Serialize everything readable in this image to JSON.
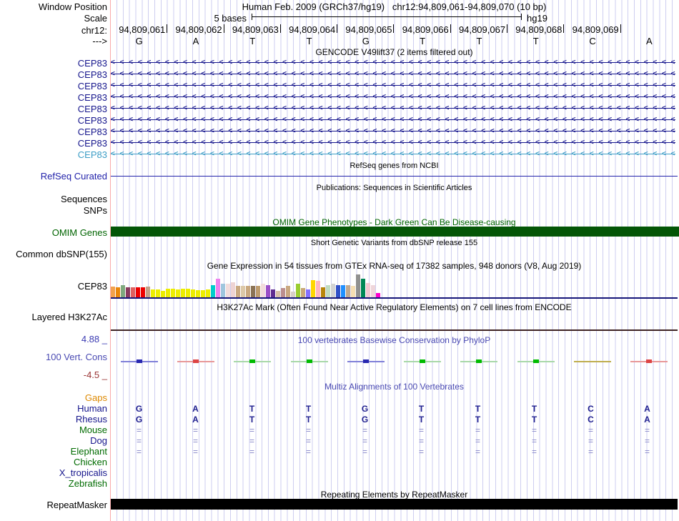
{
  "header": {
    "window_position_label": "Window Position",
    "title": "Human Feb. 2009 (GRCh37/hg19)   chr12:94,809,061-94,809,070 (10 bp)",
    "scale_label": "Scale",
    "scale_text": "5 bases",
    "assembly": "hg19",
    "chrom_label": "chr12:",
    "direction_label": "--->",
    "positions": [
      "94,809,061",
      "94,809,062",
      "94,809,063",
      "94,809,064",
      "94,809,065",
      "94,809,066",
      "94,809,067",
      "94,809,068",
      "94,809,069"
    ],
    "bases": [
      "G",
      "A",
      "T",
      "T",
      "G",
      "T",
      "T",
      "T",
      "C",
      "A"
    ]
  },
  "gencode": {
    "title": "GENCODE V49lift37 (2 items filtered out)",
    "arrow_char": "<",
    "items": [
      {
        "label": "CEP83",
        "color": "#15158C"
      },
      {
        "label": "CEP83",
        "color": "#15158C"
      },
      {
        "label": "CEP83",
        "color": "#15158C"
      },
      {
        "label": "CEP83",
        "color": "#15158C"
      },
      {
        "label": "CEP83",
        "color": "#15158C"
      },
      {
        "label": "CEP83",
        "color": "#15158C"
      },
      {
        "label": "CEP83",
        "color": "#15158C"
      },
      {
        "label": "CEP83",
        "color": "#15158C"
      },
      {
        "label": "CEP83",
        "color": "#3C9DC6"
      }
    ]
  },
  "refseq": {
    "title": "RefSeq genes from NCBI",
    "label": "RefSeq Curated",
    "color": "#2222AA"
  },
  "publications": {
    "title": "Publications: Sequences in Scientific Articles",
    "sequences_label": "Sequences",
    "snps_label": "SNPs"
  },
  "omim": {
    "title": "OMIM Gene Phenotypes - Dark Green Can Be Disease-causing",
    "label": "OMIM Genes",
    "text_color": "#006400",
    "bar_color": "#045606"
  },
  "dbsnp": {
    "title": "Short Genetic Variants from dbSNP release 155",
    "label": "Common dbSNP(155)"
  },
  "gtex": {
    "title": "Gene Expression in 54 tissues from GTEx RNA-seq of 17382 samples, 948 donors (V8, Aug 2019)",
    "label": "CEP83",
    "baseline_color": "#151578"
  },
  "h3k27ac": {
    "title": "H3K27Ac Mark (Often Found Near Active Regulatory Elements) on 7 cell lines from ENCODE",
    "label": "Layered H3K27Ac",
    "baseline_color": "#3E2323"
  },
  "conservation": {
    "title": "100 vertebrates Basewise Conservation by PhyloP",
    "label": "100 Vert. Cons",
    "max_label": "4.88 _",
    "min_label": "-4.5 _",
    "title_color": "#4949B2",
    "max_color": "#3A3AB2",
    "min_color": "#993333",
    "segments": [
      "blue",
      "red",
      "green",
      "green",
      "blue",
      "green",
      "green",
      "green",
      "olive",
      "red"
    ],
    "palette": {
      "blue": {
        "line": "#8080D8",
        "center": "#2828B0"
      },
      "red": {
        "line": "#E89898",
        "center": "#DD4444"
      },
      "green": {
        "line": "#A8D8A8",
        "center": "#00BB00"
      },
      "olive": {
        "line": "#BFAE4E",
        "center": "#BFAE4E"
      }
    }
  },
  "multiz": {
    "title": "Multiz Alignments of 100 Vertebrates",
    "title_color": "#4949B2",
    "letter_color": "#202090",
    "match_color": "#8585C8",
    "species": [
      {
        "label": "Gaps",
        "color": "#DD8800",
        "cells": [
          "",
          "",
          "",
          "",
          "",
          "",
          "",
          "",
          "",
          ""
        ]
      },
      {
        "label": "Human",
        "color": "#15158C",
        "cells": [
          "G",
          "A",
          "T",
          "T",
          "G",
          "T",
          "T",
          "T",
          "C",
          "A"
        ],
        "cell_type": "letter"
      },
      {
        "label": "Rhesus",
        "color": "#15158C",
        "cells": [
          "G",
          "A",
          "T",
          "T",
          "G",
          "T",
          "T",
          "T",
          "C",
          "A"
        ],
        "cell_type": "letter"
      },
      {
        "label": "Mouse",
        "color": "#006B00",
        "cells": [
          "=",
          "=",
          "=",
          "=",
          "=",
          "=",
          "=",
          "=",
          "=",
          "="
        ],
        "cell_type": "match"
      },
      {
        "label": "Dog",
        "color": "#15158C",
        "cells": [
          "=",
          "=",
          "=",
          "=",
          "=",
          "=",
          "=",
          "=",
          "=",
          "="
        ],
        "cell_type": "match"
      },
      {
        "label": "Elephant",
        "color": "#006B00",
        "cells": [
          "=",
          "=",
          "=",
          "=",
          "=",
          "=",
          "=",
          "=",
          "=",
          "="
        ],
        "cell_type": "match"
      },
      {
        "label": "Chicken",
        "color": "#006B00",
        "cells": [
          "",
          "",
          "",
          "",
          "",
          "",
          "",
          "",
          "",
          ""
        ]
      },
      {
        "label": "X_tropicalis",
        "color": "#15158C",
        "cells": [
          "",
          "",
          "",
          "",
          "",
          "",
          "",
          "",
          "",
          ""
        ]
      },
      {
        "label": "Zebrafish",
        "color": "#006B00",
        "cells": [
          "",
          "",
          "",
          "",
          "",
          "",
          "",
          "",
          "",
          ""
        ]
      }
    ]
  },
  "repeatmasker": {
    "title": "Repeating Elements by RepeatMasker",
    "label": "RepeatMasker",
    "bar_color": "#000000"
  },
  "chart_data": {
    "type": "bar",
    "title": "Gene Expression in 54 tissues from GTEx RNA-seq of 17382 samples, 948 donors (V8, Aug 2019)",
    "gene": "CEP83",
    "note": "bar heights estimated in pixels (max track height 36px), tissue colors as rendered",
    "values": [
      15,
      14,
      17,
      14,
      14,
      14,
      14,
      15,
      11,
      11,
      9,
      12,
      12,
      11,
      12,
      12,
      11,
      10,
      10,
      11,
      17,
      26,
      19,
      19,
      21,
      16,
      16,
      16,
      16,
      16,
      19,
      17,
      11,
      9,
      13,
      16,
      8,
      19,
      13,
      11,
      24,
      23,
      14,
      17,
      19,
      17,
      17,
      17,
      16,
      32,
      26,
      20,
      17,
      6
    ],
    "colors": [
      "#F2A14E",
      "#E8860B",
      "#7FA97F",
      "#8B3A5F",
      "#E06060",
      "#EE0000",
      "#EE0000",
      "#C2A188",
      "#EDED00",
      "#EDED00",
      "#EDED00",
      "#EDED00",
      "#EDED00",
      "#EDED00",
      "#EDED00",
      "#EDED00",
      "#EDED00",
      "#EDED00",
      "#EDED00",
      "#EDED00",
      "#00CCCC",
      "#EE82EE",
      "#9FC6DE",
      "#F2DCDC",
      "#EED3D3",
      "#C9A880",
      "#DCC8A8",
      "#C9A880",
      "#8B7355",
      "#BE9C6E",
      "#F2DCDC",
      "#9A50C8",
      "#5F2D91",
      "#D8C0A8",
      "#BC8F8F",
      "#C9A880",
      "#D8D0C8",
      "#9ACD32",
      "#C8A878",
      "#8470FF",
      "#FFD700",
      "#FFB6C1",
      "#B8860B",
      "#C0DCC0",
      "#D3D3D3",
      "#3050C8",
      "#2090FF",
      "#C0A890",
      "#F5DEB3",
      "#909090",
      "#008855",
      "#F2C8D0",
      "#EFD6DA",
      "#FF00CC"
    ]
  }
}
